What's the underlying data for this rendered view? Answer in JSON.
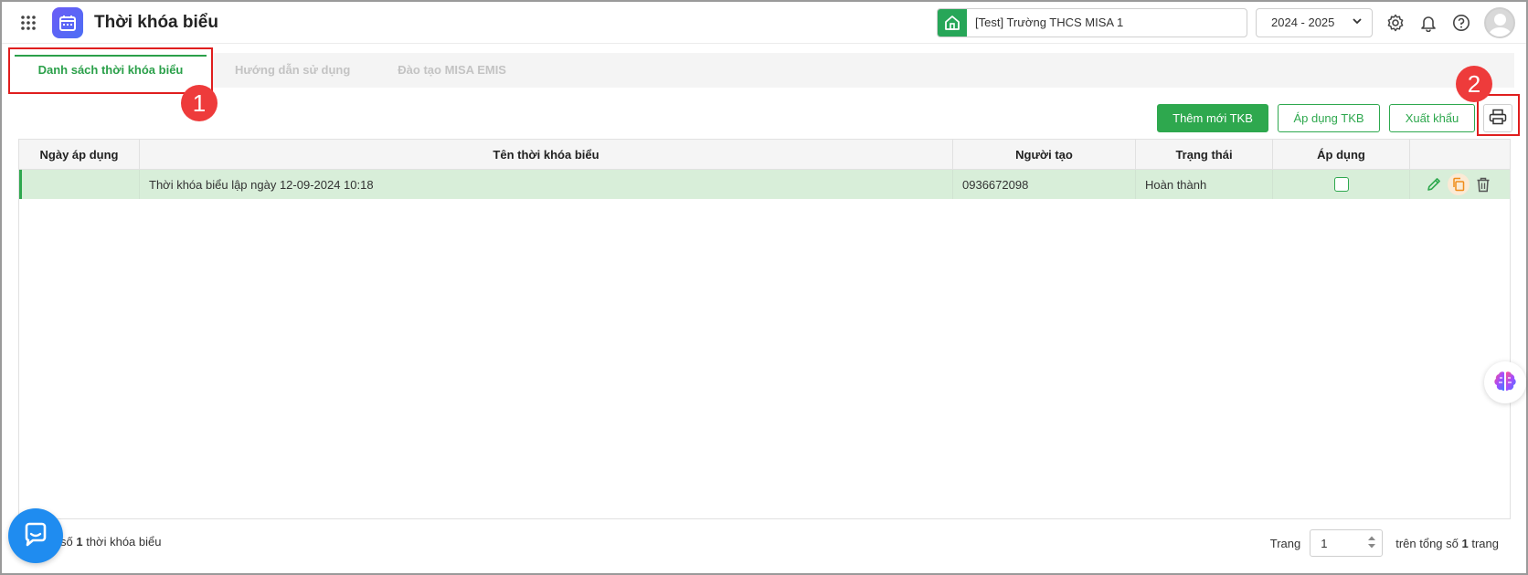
{
  "app": {
    "title": "Thời khóa biểu",
    "school": "[Test] Trường THCS MISA 1",
    "year": "2024 - 2025",
    "brand_color": "#2ea84e"
  },
  "tabs": [
    {
      "label": "Danh sách thời khóa biểu",
      "active": true
    },
    {
      "label": "Hướng dẫn sử dụng",
      "active": false
    },
    {
      "label": "Đào tạo MISA EMIS",
      "active": false
    }
  ],
  "toolbar": {
    "add_label": "Thêm mới TKB",
    "apply_label": "Áp dụng TKB",
    "export_label": "Xuất khẩu",
    "print_icon": "printer-icon"
  },
  "annotations": [
    "1",
    "2"
  ],
  "table": {
    "columns": [
      "Ngày áp dụng",
      "Tên thời khóa biểu",
      "Người tạo",
      "Trạng thái",
      "Áp dụng",
      ""
    ],
    "rows": [
      {
        "date": "",
        "name": "Thời khóa biểu lập ngày 12-09-2024 10:18",
        "creator": "0936672098",
        "status": "Hoàn thành",
        "applied": false
      }
    ]
  },
  "footer": {
    "summary_prefix": "số",
    "summary_count": "1",
    "summary_suffix": "thời khóa biểu",
    "page_label": "Trang",
    "page_value": "1",
    "total_prefix": "trên tổng số",
    "total_pages": "1",
    "total_suffix": "trang"
  }
}
